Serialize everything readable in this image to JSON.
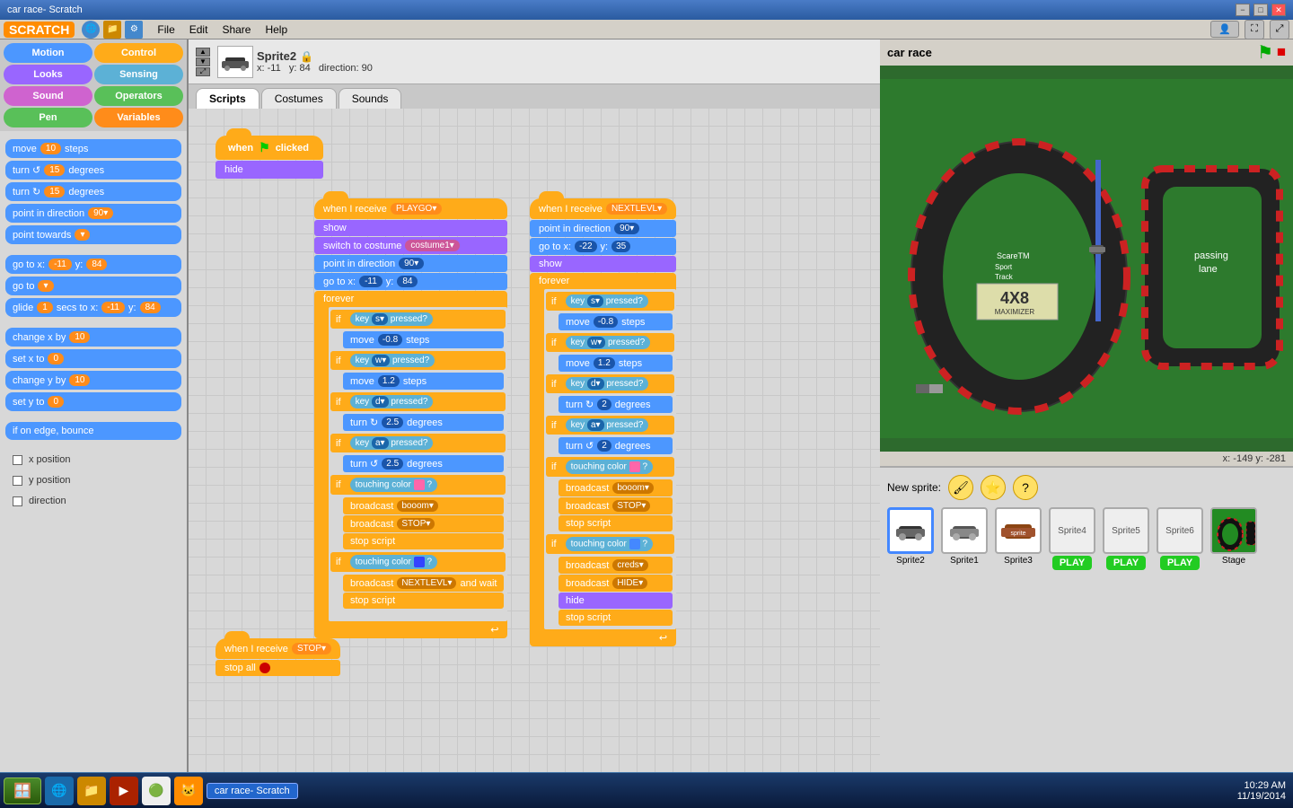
{
  "window": {
    "title": "car race- Scratch",
    "min_label": "−",
    "max_label": "□",
    "close_label": "✕"
  },
  "menu": {
    "logo": "SCRATCH",
    "items": [
      "File",
      "Edit",
      "Share",
      "Help"
    ]
  },
  "sprite_header": {
    "name": "Sprite2",
    "x": "-11",
    "y": "84",
    "direction": "90"
  },
  "tabs": [
    "Scripts",
    "Costumes",
    "Sounds"
  ],
  "categories": [
    {
      "label": "Motion",
      "class": "cat-motion"
    },
    {
      "label": "Control",
      "class": "cat-control"
    },
    {
      "label": "Looks",
      "class": "cat-looks"
    },
    {
      "label": "Sensing",
      "class": "cat-sensing"
    },
    {
      "label": "Sound",
      "class": "cat-sound"
    },
    {
      "label": "Operators",
      "class": "cat-operators"
    },
    {
      "label": "Pen",
      "class": "cat-pen"
    },
    {
      "label": "Variables",
      "class": "cat-variables"
    }
  ],
  "blocks": [
    "move 10 steps",
    "turn ↺ 15 degrees",
    "turn ↻ 15 degrees",
    "point in direction 90▾",
    "point towards ▾",
    "",
    "go to x: -11 y: 84",
    "go to ▾",
    "glide 1 secs to x: -11 y: 84",
    "",
    "change x by 10",
    "set x to 0",
    "change y by 10",
    "set y to 0",
    "",
    "if on edge, bounce",
    "",
    "☐ x position",
    "☐ y position",
    "☐ direction"
  ],
  "stage": {
    "title": "car race",
    "coords": "x: -149  y: -281"
  },
  "sprites": [
    {
      "name": "Sprite2",
      "selected": true,
      "has_play": false
    },
    {
      "name": "Sprite1",
      "selected": false,
      "has_play": false
    },
    {
      "name": "Sprite3",
      "selected": false,
      "has_play": false
    },
    {
      "name": "Sprite4",
      "selected": false,
      "has_play": true,
      "play_label": "PLAY"
    },
    {
      "name": "Sprite5",
      "selected": false,
      "has_play": true,
      "play_label": "PLAY"
    },
    {
      "name": "Sprite6",
      "selected": false,
      "has_play": true,
      "play_label": "PLAY"
    }
  ],
  "stage_sprite": {
    "name": "Stage"
  },
  "taskbar": {
    "time": "10:29 AM",
    "date": "11/19/2014",
    "active_window": "car race- Scratch"
  },
  "new_sprite_label": "New sprite:"
}
